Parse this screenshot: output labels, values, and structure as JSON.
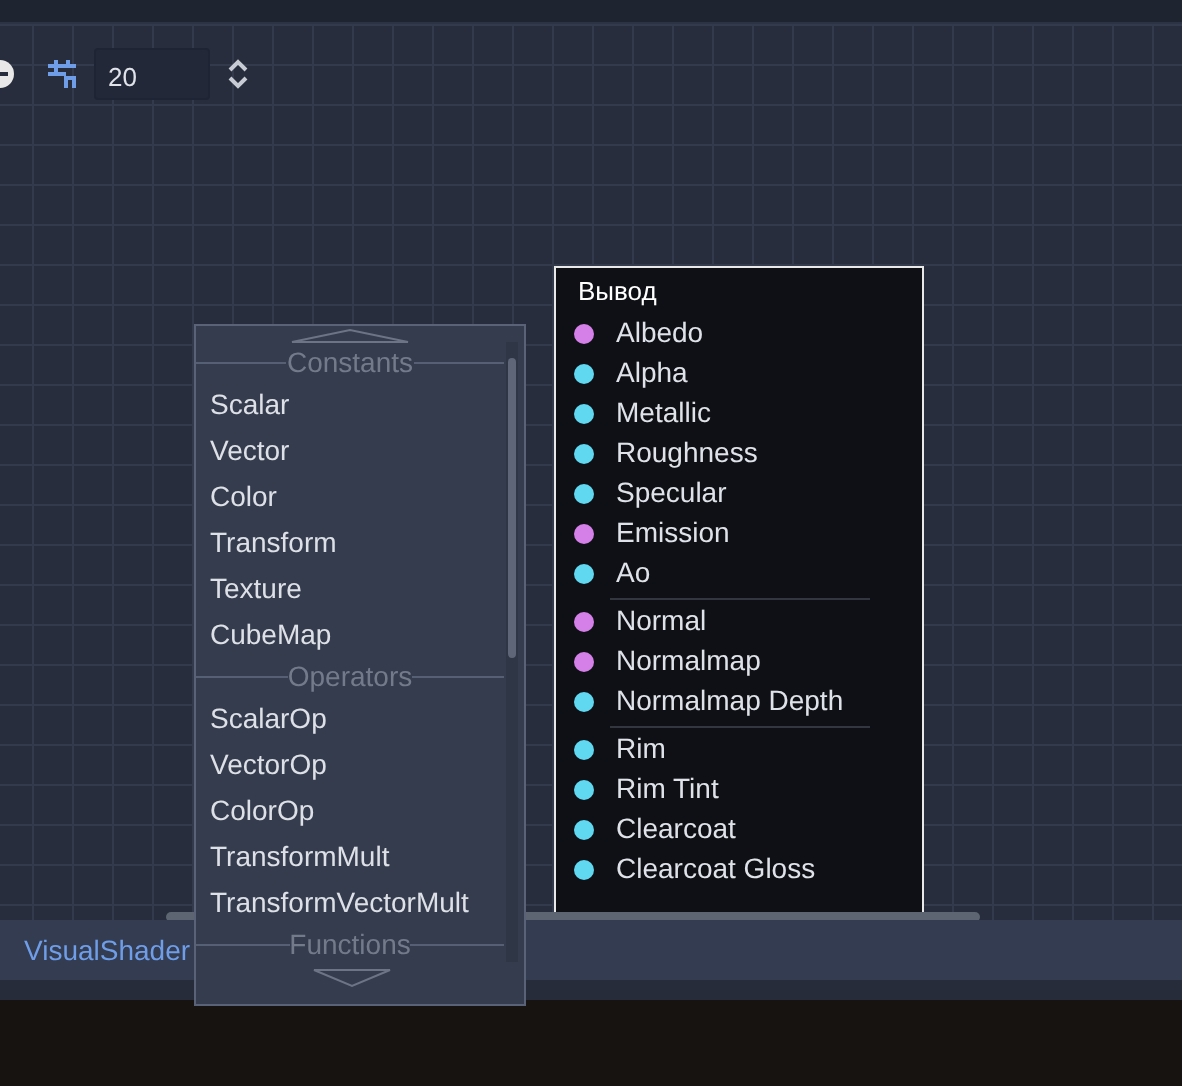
{
  "toolbar": {
    "snap_enabled": true,
    "snap_value": "20"
  },
  "output_node": {
    "title": "Вывод",
    "port_groups": [
      {
        "ports": [
          {
            "label": "Albedo",
            "color": "#d57fe8"
          },
          {
            "label": "Alpha",
            "color": "#5fd8f0"
          },
          {
            "label": "Metallic",
            "color": "#5fd8f0"
          },
          {
            "label": "Roughness",
            "color": "#5fd8f0"
          },
          {
            "label": "Specular",
            "color": "#5fd8f0"
          },
          {
            "label": "Emission",
            "color": "#d57fe8"
          },
          {
            "label": "Ao",
            "color": "#5fd8f0"
          }
        ]
      },
      {
        "ports": [
          {
            "label": "Normal",
            "color": "#d57fe8"
          },
          {
            "label": "Normalmap",
            "color": "#d57fe8"
          },
          {
            "label": "Normalmap Depth",
            "color": "#5fd8f0"
          }
        ]
      },
      {
        "ports": [
          {
            "label": "Rim",
            "color": "#5fd8f0"
          },
          {
            "label": "Rim Tint",
            "color": "#5fd8f0"
          },
          {
            "label": "Clearcoat",
            "color": "#5fd8f0"
          },
          {
            "label": "Clearcoat Gloss",
            "color": "#5fd8f0"
          }
        ]
      }
    ]
  },
  "add_menu": {
    "items": [
      {
        "kind": "header",
        "label": "Constants"
      },
      {
        "kind": "item",
        "label": "Scalar"
      },
      {
        "kind": "item",
        "label": "Vector"
      },
      {
        "kind": "item",
        "label": "Color"
      },
      {
        "kind": "item",
        "label": "Transform"
      },
      {
        "kind": "item",
        "label": "Texture"
      },
      {
        "kind": "item",
        "label": "CubeMap"
      },
      {
        "kind": "header",
        "label": "Operators"
      },
      {
        "kind": "item",
        "label": "ScalarOp"
      },
      {
        "kind": "item",
        "label": "VectorOp"
      },
      {
        "kind": "item",
        "label": "ColorOp"
      },
      {
        "kind": "item",
        "label": "TransformMult"
      },
      {
        "kind": "item",
        "label": "TransformVectorMult"
      },
      {
        "kind": "header",
        "label": "Functions"
      }
    ]
  },
  "bottom_panel": {
    "tab": "VisualShader"
  }
}
